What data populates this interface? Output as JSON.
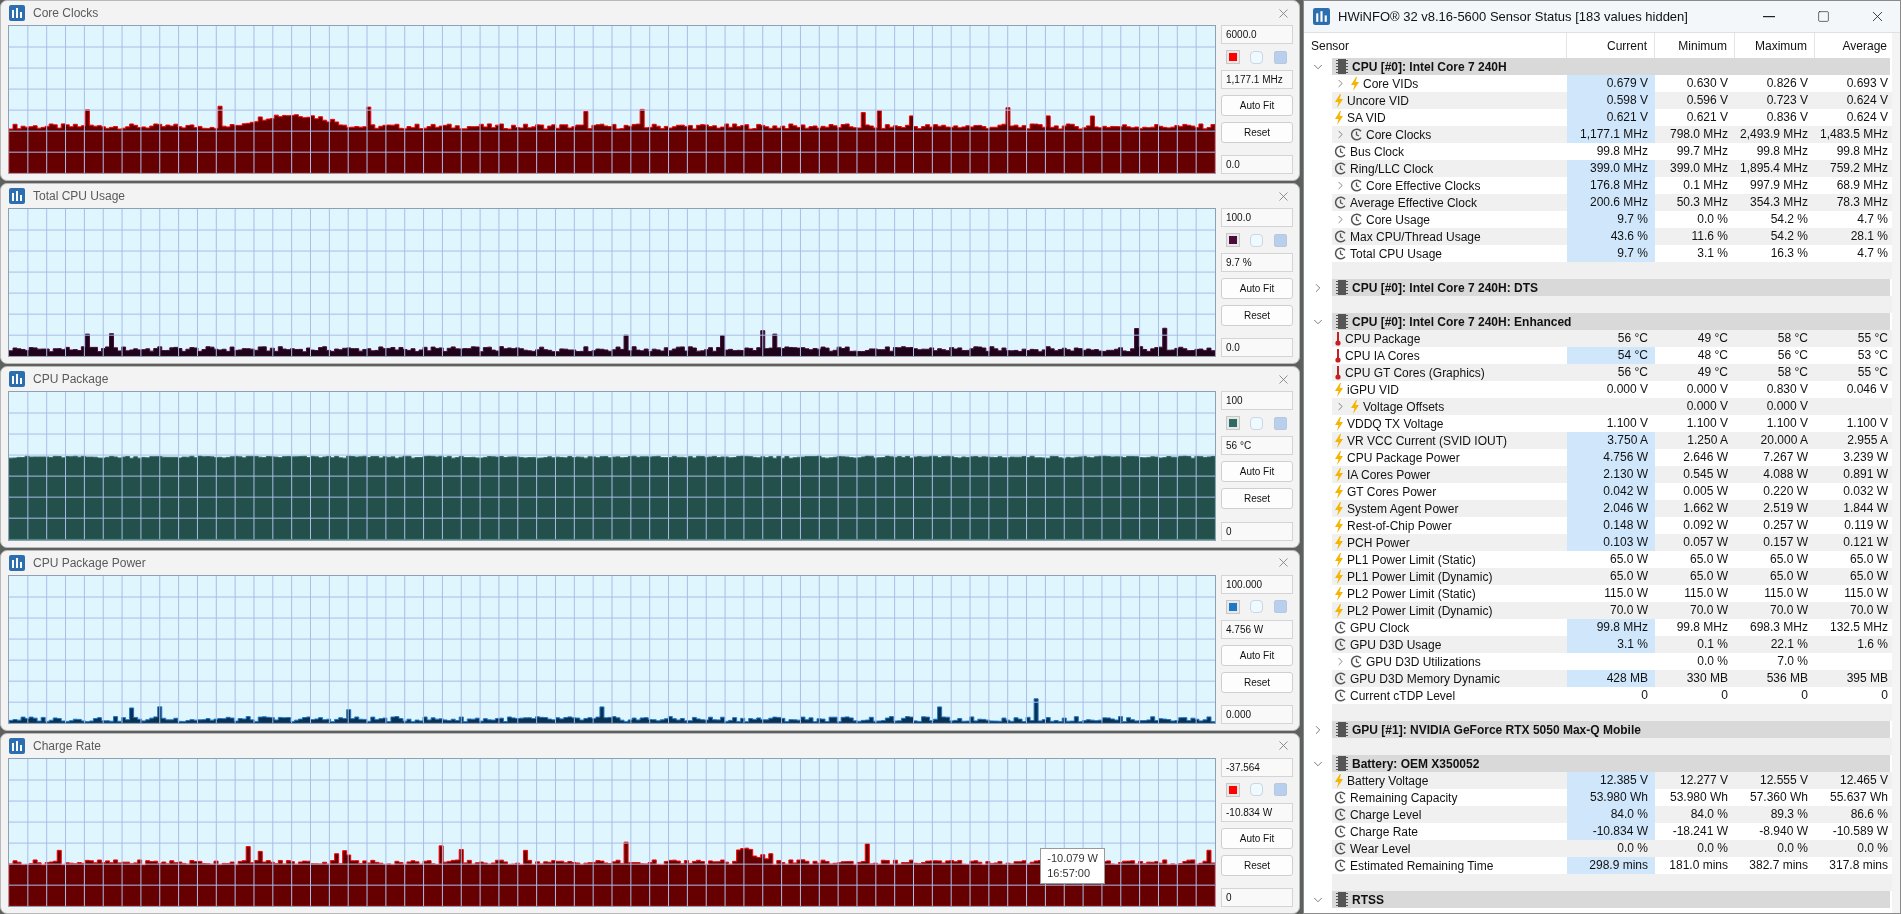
{
  "graphs": [
    {
      "title": "Core Clocks",
      "max": "6000.0",
      "current": "1,177.1 MHz",
      "min": "0.0",
      "color": "#ff0000",
      "buttons": [
        "Auto Fit",
        "Reset"
      ]
    },
    {
      "title": "Total CPU Usage",
      "max": "100.0",
      "current": "9.7 %",
      "min": "0.0",
      "color": "#4a0a3c",
      "buttons": [
        "Auto Fit",
        "Reset"
      ]
    },
    {
      "title": "CPU Package",
      "max": "100",
      "current": "56 °C",
      "min": "0",
      "color": "#2e6b63",
      "buttons": [
        "Auto Fit",
        "Reset"
      ]
    },
    {
      "title": "CPU Package Power",
      "max": "100.000",
      "current": "4.756 W",
      "min": "0.000",
      "color": "#1e78c8",
      "buttons": [
        "Auto Fit",
        "Reset"
      ]
    },
    {
      "title": "Charge Rate",
      "max": "-37.564",
      "current": "-10.834 W",
      "min": "0",
      "color": "#ff0000",
      "buttons": [
        "Auto Fit",
        "Reset"
      ],
      "tooltip": {
        "value": "-10.079 W",
        "time": "16:57:00"
      }
    }
  ],
  "sensor_window": {
    "title": "HWiNFO® 32 v8.16-5600 Sensor Status [183 values hidden]",
    "columns": [
      "Sensor",
      "Current",
      "Minimum",
      "Maximum",
      "Average"
    ],
    "groups": [
      {
        "name": "CPU [#0]: Intel Core 7 240H",
        "expanded": true,
        "rows": [
          {
            "name": "Core VIDs",
            "kind": "voltage",
            "expandable": true,
            "highlighted": true,
            "current": "0.679 V",
            "minimum": "0.630 V",
            "maximum": "0.826 V",
            "average": "0.693 V"
          },
          {
            "name": "Uncore VID",
            "kind": "voltage",
            "expandable": false,
            "highlighted": true,
            "current": "0.598 V",
            "minimum": "0.596 V",
            "maximum": "0.723 V",
            "average": "0.624 V"
          },
          {
            "name": "SA VID",
            "kind": "voltage",
            "expandable": false,
            "highlighted": true,
            "current": "0.621 V",
            "minimum": "0.621 V",
            "maximum": "0.836 V",
            "average": "0.624 V"
          },
          {
            "name": "Core Clocks",
            "kind": "clock",
            "expandable": true,
            "highlighted": true,
            "current": "1,177.1 MHz",
            "minimum": "798.0 MHz",
            "maximum": "2,493.9 MHz",
            "average": "1,483.5 MHz"
          },
          {
            "name": "Bus Clock",
            "kind": "clock",
            "expandable": false,
            "highlighted": false,
            "current": "99.8 MHz",
            "minimum": "99.7 MHz",
            "maximum": "99.8 MHz",
            "average": "99.8 MHz"
          },
          {
            "name": "Ring/LLC Clock",
            "kind": "clock",
            "expandable": false,
            "highlighted": true,
            "current": "399.0 MHz",
            "minimum": "399.0 MHz",
            "maximum": "1,895.4 MHz",
            "average": "759.2 MHz"
          },
          {
            "name": "Core Effective Clocks",
            "kind": "clock",
            "expandable": true,
            "highlighted": true,
            "current": "176.8 MHz",
            "minimum": "0.1 MHz",
            "maximum": "997.9 MHz",
            "average": "68.9 MHz"
          },
          {
            "name": "Average Effective Clock",
            "kind": "clock",
            "expandable": false,
            "highlighted": true,
            "current": "200.6 MHz",
            "minimum": "50.3 MHz",
            "maximum": "354.3 MHz",
            "average": "78.3 MHz"
          },
          {
            "name": "Core Usage",
            "kind": "clock",
            "expandable": true,
            "highlighted": true,
            "current": "9.7 %",
            "minimum": "0.0 %",
            "maximum": "54.2 %",
            "average": "4.7 %"
          },
          {
            "name": "Max CPU/Thread Usage",
            "kind": "clock",
            "expandable": false,
            "highlighted": true,
            "current": "43.6 %",
            "minimum": "11.6 %",
            "maximum": "54.2 %",
            "average": "28.1 %"
          },
          {
            "name": "Total CPU Usage",
            "kind": "clock",
            "expandable": false,
            "highlighted": true,
            "current": "9.7 %",
            "minimum": "3.1 %",
            "maximum": "16.3 %",
            "average": "4.7 %"
          }
        ]
      },
      {
        "name": "CPU [#0]: Intel Core 7 240H: DTS",
        "expanded": false
      },
      {
        "name": "CPU [#0]: Intel Core 7 240H: Enhanced",
        "expanded": true,
        "rows": [
          {
            "name": "CPU Package",
            "kind": "temperature",
            "expandable": false,
            "highlighted": false,
            "current": "56 °C",
            "minimum": "49 °C",
            "maximum": "58 °C",
            "average": "55 °C"
          },
          {
            "name": "CPU IA Cores",
            "kind": "temperature",
            "expandable": false,
            "highlighted": true,
            "current": "54 °C",
            "minimum": "48 °C",
            "maximum": "56 °C",
            "average": "53 °C"
          },
          {
            "name": "CPU GT Cores (Graphics)",
            "kind": "temperature",
            "expandable": false,
            "highlighted": false,
            "current": "56 °C",
            "minimum": "49 °C",
            "maximum": "58 °C",
            "average": "55 °C"
          },
          {
            "name": "iGPU VID",
            "kind": "voltage",
            "expandable": false,
            "highlighted": false,
            "current": "0.000 V",
            "minimum": "0.000 V",
            "maximum": "0.830 V",
            "average": "0.046 V"
          },
          {
            "name": "Voltage Offsets",
            "kind": "voltage",
            "expandable": true,
            "highlighted": false,
            "minimum": "0.000 V",
            "maximum": "0.000 V"
          },
          {
            "name": "VDDQ TX Voltage",
            "kind": "voltage",
            "expandable": false,
            "highlighted": false,
            "current": "1.100 V",
            "minimum": "1.100 V",
            "maximum": "1.100 V",
            "average": "1.100 V"
          },
          {
            "name": "VR VCC Current (SVID IOUT)",
            "kind": "voltage",
            "expandable": false,
            "highlighted": true,
            "current": "3.750 A",
            "minimum": "1.250 A",
            "maximum": "20.000 A",
            "average": "2.955 A"
          },
          {
            "name": "CPU Package Power",
            "kind": "voltage",
            "expandable": false,
            "highlighted": true,
            "current": "4.756 W",
            "minimum": "2.646 W",
            "maximum": "7.267 W",
            "average": "3.239 W"
          },
          {
            "name": "IA Cores Power",
            "kind": "voltage",
            "expandable": false,
            "highlighted": true,
            "current": "2.130 W",
            "minimum": "0.545 W",
            "maximum": "4.088 W",
            "average": "0.891 W"
          },
          {
            "name": "GT Cores Power",
            "kind": "voltage",
            "expandable": false,
            "highlighted": true,
            "current": "0.042 W",
            "minimum": "0.005 W",
            "maximum": "0.220 W",
            "average": "0.032 W"
          },
          {
            "name": "System Agent Power",
            "kind": "voltage",
            "expandable": false,
            "highlighted": true,
            "current": "2.046 W",
            "minimum": "1.662 W",
            "maximum": "2.519 W",
            "average": "1.844 W"
          },
          {
            "name": "Rest-of-Chip Power",
            "kind": "voltage",
            "expandable": false,
            "highlighted": true,
            "current": "0.148 W",
            "minimum": "0.092 W",
            "maximum": "0.257 W",
            "average": "0.119 W"
          },
          {
            "name": "PCH Power",
            "kind": "voltage",
            "expandable": false,
            "highlighted": true,
            "current": "0.103 W",
            "minimum": "0.057 W",
            "maximum": "0.157 W",
            "average": "0.121 W"
          },
          {
            "name": "PL1 Power Limit (Static)",
            "kind": "voltage",
            "expandable": false,
            "highlighted": false,
            "current": "65.0 W",
            "minimum": "65.0 W",
            "maximum": "65.0 W",
            "average": "65.0 W"
          },
          {
            "name": "PL1 Power Limit (Dynamic)",
            "kind": "voltage",
            "expandable": false,
            "highlighted": false,
            "current": "65.0 W",
            "minimum": "65.0 W",
            "maximum": "65.0 W",
            "average": "65.0 W"
          },
          {
            "name": "PL2 Power Limit (Static)",
            "kind": "voltage",
            "expandable": false,
            "highlighted": false,
            "current": "115.0 W",
            "minimum": "115.0 W",
            "maximum": "115.0 W",
            "average": "115.0 W"
          },
          {
            "name": "PL2 Power Limit (Dynamic)",
            "kind": "voltage",
            "expandable": false,
            "highlighted": false,
            "current": "70.0 W",
            "minimum": "70.0 W",
            "maximum": "70.0 W",
            "average": "70.0 W"
          },
          {
            "name": "GPU Clock",
            "kind": "clock",
            "expandable": false,
            "highlighted": true,
            "current": "99.8 MHz",
            "minimum": "99.8 MHz",
            "maximum": "698.3 MHz",
            "average": "132.5 MHz"
          },
          {
            "name": "GPU D3D Usage",
            "kind": "clock",
            "expandable": false,
            "highlighted": true,
            "current": "3.1 %",
            "minimum": "0.1 %",
            "maximum": "22.1 %",
            "average": "1.6 %"
          },
          {
            "name": "GPU D3D Utilizations",
            "kind": "clock",
            "expandable": true,
            "highlighted": false,
            "minimum": "0.0 %",
            "maximum": "7.0 %"
          },
          {
            "name": "GPU D3D Memory Dynamic",
            "kind": "clock",
            "expandable": false,
            "highlighted": true,
            "current": "428 MB",
            "minimum": "330 MB",
            "maximum": "536 MB",
            "average": "395 MB"
          },
          {
            "name": "Current cTDP Level",
            "kind": "clock",
            "expandable": false,
            "highlighted": false,
            "current": "0",
            "minimum": "0",
            "maximum": "0",
            "average": "0"
          }
        ]
      },
      {
        "name": "GPU [#1]: NVIDIA  GeForce RTX 5050 Max-Q Mobile",
        "expanded": false
      },
      {
        "name": "Battery: OEM X350052",
        "expanded": true,
        "rows": [
          {
            "name": "Battery Voltage",
            "kind": "voltage",
            "expandable": false,
            "highlighted": true,
            "current": "12.385 V",
            "minimum": "12.277 V",
            "maximum": "12.555 V",
            "average": "12.465 V"
          },
          {
            "name": "Remaining Capacity",
            "kind": "clock",
            "expandable": false,
            "highlighted": true,
            "current": "53.980 Wh",
            "minimum": "53.980 Wh",
            "maximum": "57.360 Wh",
            "average": "55.637 Wh"
          },
          {
            "name": "Charge Level",
            "kind": "clock",
            "expandable": false,
            "highlighted": true,
            "current": "84.0 %",
            "minimum": "84.0 %",
            "maximum": "89.3 %",
            "average": "86.6 %"
          },
          {
            "name": "Charge Rate",
            "kind": "clock",
            "expandable": false,
            "highlighted": true,
            "current": "-10.834 W",
            "minimum": "-18.241 W",
            "maximum": "-8.940 W",
            "average": "-10.589 W"
          },
          {
            "name": "Wear Level",
            "kind": "clock",
            "expandable": false,
            "highlighted": false,
            "current": "0.0 %",
            "minimum": "0.0 %",
            "maximum": "0.0 %",
            "average": "0.0 %"
          },
          {
            "name": "Estimated Remaining Time",
            "kind": "clock",
            "expandable": false,
            "highlighted": true,
            "current": "298.9 mins",
            "minimum": "181.0 mins",
            "maximum": "382.7 mins",
            "average": "317.8 mins"
          }
        ]
      },
      {
        "name": "RTSS",
        "expanded": true
      }
    ]
  }
}
